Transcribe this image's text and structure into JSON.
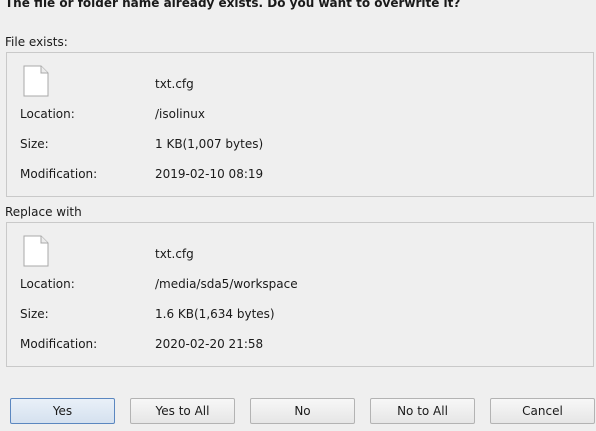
{
  "dialog": {
    "question": "The file or folder name already exists. Do you want to overwrite it?"
  },
  "existing": {
    "heading": "File exists:",
    "name": "txt.cfg",
    "location_label": "Location:",
    "location": "/isolinux",
    "size_label": "Size:",
    "size": "1 KB(1,007 bytes)",
    "modification_label": "Modification:",
    "modification": "2019-02-10 08:19"
  },
  "replacement": {
    "heading": "Replace with",
    "name": "txt.cfg",
    "location_label": "Location:",
    "location": "/media/sda5/workspace",
    "size_label": "Size:",
    "size": "1.6 KB(1,634 bytes)",
    "modification_label": "Modification:",
    "modification": "2020-02-20 21:58"
  },
  "buttons": {
    "yes": "Yes",
    "yes_to_all": "Yes to All",
    "no": "No",
    "no_to_all": "No to All",
    "cancel": "Cancel"
  },
  "icons": {
    "file": "file-document-icon"
  }
}
